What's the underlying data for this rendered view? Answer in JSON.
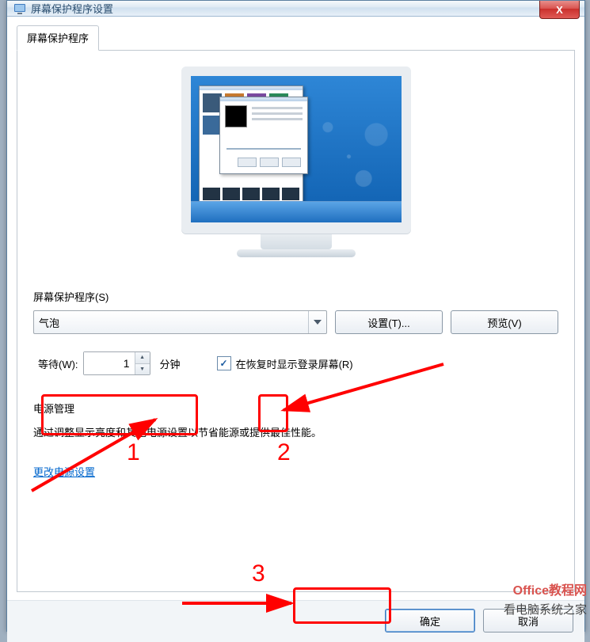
{
  "window": {
    "title": "屏幕保护程序设置",
    "close_symbol": "X"
  },
  "tab": {
    "label": "屏幕保护程序"
  },
  "screensaver": {
    "group_label": "屏幕保护程序(S)",
    "selected": "气泡",
    "settings_btn": "设置(T)...",
    "preview_btn": "预览(V)"
  },
  "wait": {
    "label": "等待(W):",
    "value": "1",
    "unit": "分钟"
  },
  "resume": {
    "checked": true,
    "check_glyph": "✓",
    "label": "在恢复时显示登录屏幕(R)"
  },
  "power": {
    "title": "电源管理",
    "desc": "通过调整显示亮度和其他电源设置以节省能源或提供最佳性能。",
    "link": "更改电源设置"
  },
  "footer": {
    "ok": "确定",
    "cancel": "取消"
  },
  "annotations": {
    "n1": "1",
    "n2": "2",
    "n3": "3"
  },
  "watermark": {
    "line1": "Office教程网",
    "line2": "看电脑系统之家"
  }
}
